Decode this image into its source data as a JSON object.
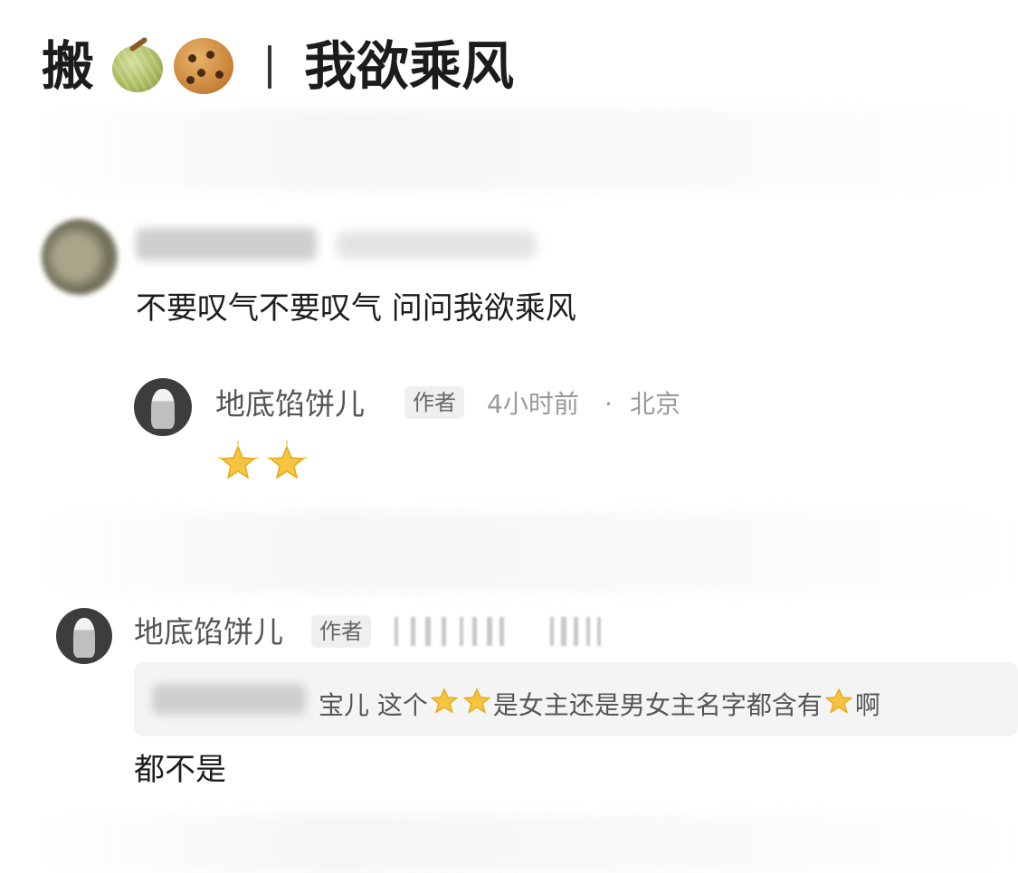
{
  "title": {
    "prefix": "搬",
    "emoji": [
      "melon-emoji",
      "cookie-emoji"
    ],
    "separator": "|",
    "main": "我欲乘风"
  },
  "comment_1": {
    "text": "不要叹气不要叹气 问问我欲乘风",
    "reply": {
      "username": "地底馅饼儿",
      "author_tag": "作者",
      "time": "4小时前",
      "dot": "·",
      "location": "北京",
      "content_icons": [
        "star-emoji",
        "star-emoji"
      ]
    }
  },
  "comment_2": {
    "username": "地底馅饼儿",
    "author_tag": "作者",
    "quote": {
      "part1": "宝儿 这个",
      "part2": "是女主还是男女主名字都含有",
      "part3": "啊"
    },
    "text": "都不是"
  },
  "colors": {
    "text_primary": "#1e1e1e",
    "text_secondary": "#555555",
    "text_meta": "#9a9a9a",
    "tag_bg": "#efefef",
    "quote_bg": "#f4f4f4",
    "star": "#f5c542"
  }
}
